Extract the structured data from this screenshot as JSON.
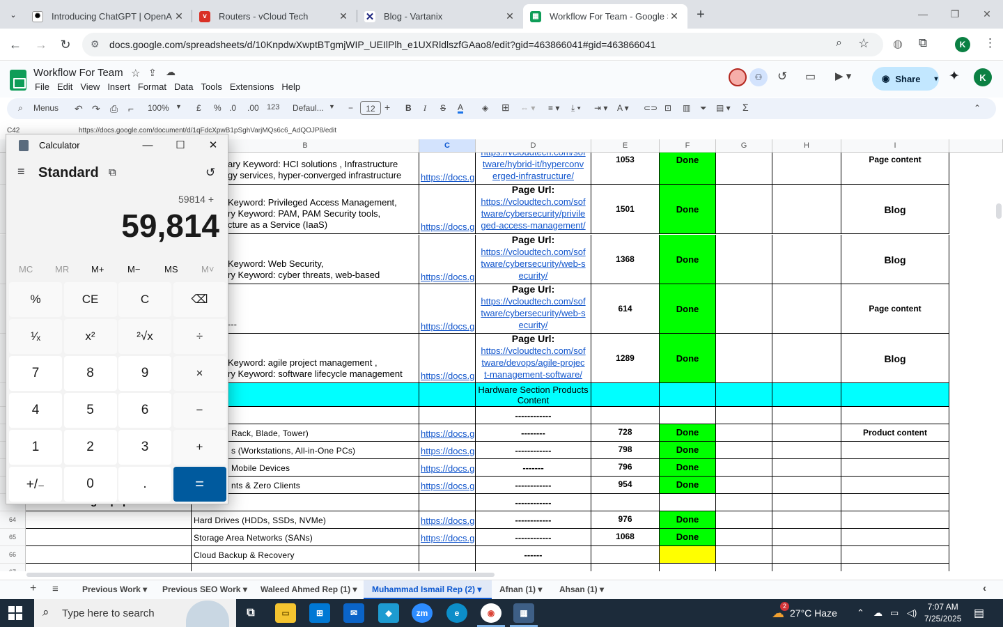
{
  "browser": {
    "tabs": [
      {
        "title": "Introducing ChatGPT | OpenAI",
        "icon": "openai-icon"
      },
      {
        "title": "Routers - vCloud Tech",
        "icon": "vcloud-icon"
      },
      {
        "title": "Blog - Vartanix",
        "icon": "vartanix-icon"
      },
      {
        "title": "Workflow For Team - Google Sh",
        "icon": "google-sheets-icon"
      }
    ],
    "url": "docs.google.com/spreadsheets/d/10KnpdwXwptBTgmjWIP_UEIlPlh_e1UXRldlszfGAao8/edit?gid=463866041#gid=463866041",
    "profile_initial": "K"
  },
  "sheets": {
    "title": "Workflow For Team",
    "menu": [
      "File",
      "Edit",
      "View",
      "Insert",
      "Format",
      "Data",
      "Tools",
      "Extensions",
      "Help"
    ],
    "share_label": "Share",
    "user_initial": "K",
    "toolbar": {
      "search": "Menus",
      "zoom": "100%",
      "currency": "£",
      "percent": "%",
      "dec_down": ".0",
      "dec_up": ".00",
      "num_format": "123",
      "font": "Defaul...",
      "font_size": "12"
    },
    "cell_ref": "C42",
    "formula_text": "https://docs.google.com/document/d/1qFdcXpwB1pSghVarjMQs6c6_AdQOJP8/edit",
    "columns": [
      "A",
      "B",
      "C",
      "D",
      "E",
      "F",
      "G",
      "H",
      "I"
    ],
    "selected_column": "C",
    "big_rows": [
      {
        "b_lines": [
          "ary Keyword: HCI solutions , Infrastructure",
          "gy services, hyper-converged infrastructure"
        ],
        "c": "https://docs.g",
        "d_head": "",
        "d_link": [
          "tware/hybrid-it/hyperconv",
          "erged-infrastructure/"
        ],
        "d_prefix": "https://vcloudtech.com/sof",
        "e": "1053",
        "f": "Done",
        "i": "Page content"
      },
      {
        "b_lines": [
          "Keyword: Privileged Access Management,",
          "ry Keyword: PAM, PAM Security tools,",
          "cture as a Service (IaaS)"
        ],
        "c": "https://docs.g",
        "d_head": "Page Url:",
        "d_link": [
          "https://vcloudtech.com/sof",
          "tware/cybersecurity/privile",
          "ged-access-management/"
        ],
        "e": "1501",
        "f": "Done",
        "i": "Blog"
      },
      {
        "b_lines": [
          "Keyword: Web Security,",
          "ry Keyword: cyber threats, web-based"
        ],
        "c": "https://docs.g",
        "d_head": "Page Url:",
        "d_link": [
          "https://vcloudtech.com/sof",
          "tware/cybersecurity/web-s",
          "ecurity/"
        ],
        "e": "1368",
        "f": "Done",
        "i": "Blog"
      },
      {
        "b_lines": [
          "---"
        ],
        "c": "https://docs.g",
        "d_head": "Page Url:",
        "d_link": [
          "https://vcloudtech.com/sof",
          "tware/cybersecurity/web-s",
          "ecurity/"
        ],
        "e": "614",
        "f": "Done",
        "i": "Page content"
      },
      {
        "b_lines": [
          "Keyword:  agile project management ,",
          "ry Keyword:  software lifecycle management"
        ],
        "c": "https://docs.g",
        "d_head": "Page Url:",
        "d_link": [
          "https://vcloudtech.com/sof",
          "tware/devops/agile-projec",
          "t-management-software/"
        ],
        "e": "1289",
        "f": "Done",
        "i": "Blog"
      }
    ],
    "section_row": {
      "d": [
        "Hardware Section Products",
        "Content"
      ]
    },
    "small_rows": [
      {
        "num": "",
        "a": "",
        "b": "",
        "c": "",
        "d": "------------",
        "e": "",
        "f": "",
        "i": ""
      },
      {
        "num": "",
        "a": "",
        "b": "Rack, Blade, Tower)",
        "c": "https://docs.g",
        "d": "--------",
        "e": "728",
        "f": "Done",
        "i": "Product content"
      },
      {
        "num": "",
        "a": "",
        "b": "s (Workstations, All-in-One PCs)",
        "c": "https://docs.g",
        "d": "------------",
        "e": "798",
        "f": "Done",
        "i": ""
      },
      {
        "num": "",
        "a": "",
        "b": "Mobile Devices",
        "c": "https://docs.g",
        "d": "-------",
        "e": "796",
        "f": "Done",
        "i": ""
      },
      {
        "num": "",
        "a": "",
        "b": "nts & Zero Clients",
        "c": "https://docs.g",
        "d": "------------",
        "e": "954",
        "f": "Done",
        "i": ""
      },
      {
        "num": "",
        "a": "2. Networking Equipment",
        "b": "",
        "c": "",
        "d": "------------",
        "e": "",
        "f": "",
        "i": ""
      },
      {
        "num": "64",
        "a": "",
        "b": "Hard Drives (HDDs, SSDs, NVMe)",
        "c": "https://docs.g",
        "d": "------------",
        "e": "976",
        "f": "Done",
        "i": ""
      },
      {
        "num": "65",
        "a": "",
        "b": "Storage Area Networks (SANs)",
        "c": "https://docs.g",
        "d": "------------",
        "e": "1068",
        "f": "Done",
        "i": ""
      },
      {
        "num": "66",
        "a": "",
        "b": "Cloud Backup & Recovery",
        "c": "",
        "d": "------",
        "e": "",
        "f": "",
        "i": "",
        "f_color": "yellow"
      },
      {
        "num": "67",
        "a": "",
        "b": "",
        "c": "",
        "d": "",
        "e": "",
        "f": "",
        "i": ""
      }
    ],
    "sheet_tabs": [
      "Previous Work",
      "Previous SEO Work",
      "Waleed Ahmed Rep (1)",
      "Muhammad Ismail Rep (2)",
      "Afnan (1)",
      "Ahsan (1)"
    ],
    "active_sheet": "Muhammad Ismail Rep (2)"
  },
  "calculator": {
    "title": "Calculator",
    "mode": "Standard",
    "expression": "59814 +",
    "display": "59,814",
    "memory": [
      "MC",
      "MR",
      "M+",
      "M−",
      "MS",
      "M˅"
    ],
    "keys": [
      [
        "%",
        "CE",
        "C",
        "⌫"
      ],
      [
        "¹⁄ₓ",
        "x²",
        "²√x",
        "÷"
      ],
      [
        "7",
        "8",
        "9",
        "×"
      ],
      [
        "4",
        "5",
        "6",
        "−"
      ],
      [
        "1",
        "2",
        "3",
        "+"
      ],
      [
        "+/₋",
        "0",
        ".",
        "="
      ]
    ]
  },
  "taskbar": {
    "search_placeholder": "Type here to search",
    "weather": "27°C  Haze",
    "weather_badge": "2",
    "time": "7:07 AM",
    "date": "7/25/2025"
  }
}
